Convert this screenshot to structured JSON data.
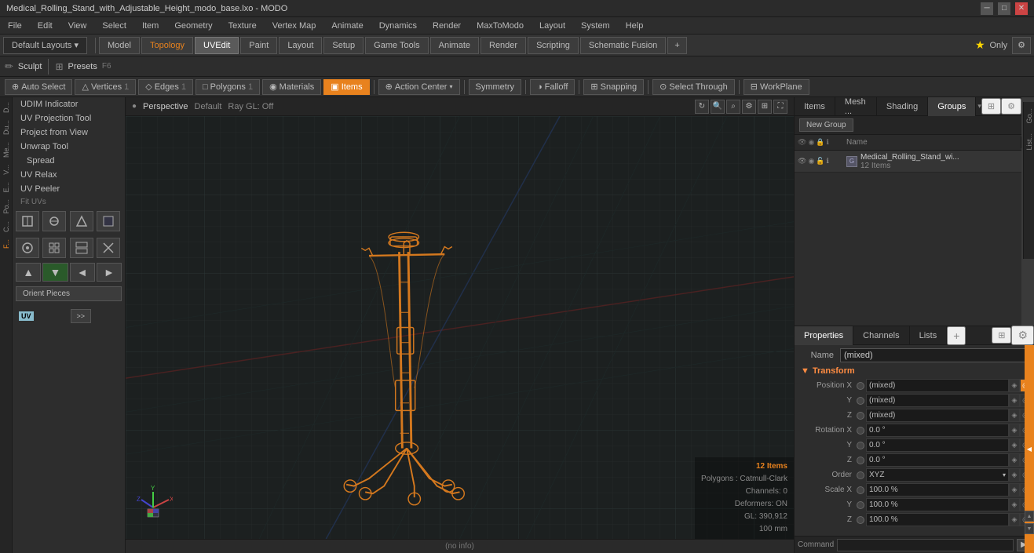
{
  "titlebar": {
    "title": "Medical_Rolling_Stand_with_Adjustable_Height_modo_base.lxo - MODO",
    "min": "─",
    "max": "□",
    "close": "✕"
  },
  "menubar": {
    "items": [
      "File",
      "Edit",
      "View",
      "Select",
      "Item",
      "Geometry",
      "Texture",
      "Vertex Map",
      "Animate",
      "Dynamics",
      "Render",
      "MaxToModo",
      "Layout",
      "System",
      "Help"
    ]
  },
  "toolbar": {
    "layouts_label": "Default Layouts ▾",
    "tabs": [
      {
        "label": "Model",
        "active": false
      },
      {
        "label": "Topology",
        "active": false
      },
      {
        "label": "UVEdit",
        "active": true
      },
      {
        "label": "Paint",
        "active": false
      },
      {
        "label": "Layout",
        "active": false
      },
      {
        "label": "Setup",
        "active": false
      },
      {
        "label": "Game Tools",
        "active": false
      },
      {
        "label": "Animate",
        "active": false
      },
      {
        "label": "Render",
        "active": false
      },
      {
        "label": "Scripting",
        "active": false
      },
      {
        "label": "Schematic Fusion",
        "active": false
      }
    ],
    "add_btn": "+",
    "star_btn": "★",
    "only_label": "Only",
    "settings_btn": "⚙"
  },
  "sculpt_bar": {
    "sculpt_label": "Sculpt",
    "presets_label": "Presets",
    "presets_shortcut": "F6"
  },
  "selection_bar": {
    "auto_select": "Auto Select",
    "vertices": "Vertices",
    "edges": "Edges",
    "polygons": "Polygons",
    "materials": "Materials",
    "items": "Items",
    "action_center": "Action Center",
    "symmetry": "Symmetry",
    "falloff": "Falloff",
    "snapping": "Snapping",
    "select_through": "Select Through",
    "workplane": "WorkPlane"
  },
  "left_tools": {
    "items": [
      {
        "label": "UDIM Indicator"
      },
      {
        "label": "UV Projection Tool"
      },
      {
        "label": "Project from View"
      },
      {
        "label": "Unwrap Tool"
      },
      {
        "label": "Spread",
        "indent": true
      },
      {
        "label": "UV Relax"
      },
      {
        "label": "UV Peeler"
      },
      {
        "label": "Fit UVs",
        "section": true
      }
    ],
    "tool_icons_row1": [
      "⊕",
      "☕",
      "⊞",
      "▣"
    ],
    "tool_icons_row2": [
      "☼",
      "⊡",
      "▦",
      "▤"
    ],
    "arrow_btns": [
      "▲",
      "▼",
      "◄",
      "►"
    ],
    "orient_label": "Orient Pieces",
    "uv_badge": "UV",
    "expand_btn": ">>"
  },
  "left_sidebar_tabs": [
    "D...",
    "Du...",
    "Me...",
    "V...",
    "E...",
    "Po...",
    "C...",
    "F..."
  ],
  "viewport": {
    "view_label": "Perspective",
    "shading_label": "Default",
    "ray_label": "Ray GL: Off",
    "status": {
      "items": "12 Items",
      "polygons": "Polygons : Catmull-Clark",
      "channels": "Channels: 0",
      "deformers": "Deformers: ON",
      "gl": "GL: 390,912",
      "size": "100 mm"
    },
    "bottom_status": "(no info)"
  },
  "right_panel": {
    "tabs": [
      "Items",
      "Mesh ...",
      "Shading",
      "Groups"
    ],
    "active_tab": "Groups",
    "expand_btn": "⊞",
    "settings_btn": "⚙",
    "new_group_btn": "New Group",
    "columns": {
      "name": "Name"
    },
    "groups": [
      {
        "type": "group",
        "icon": "G",
        "name": "Medical_Rolling_Stand_wi...",
        "count": "12 Items",
        "children": []
      }
    ]
  },
  "properties": {
    "tabs": [
      "Properties",
      "Channels",
      "Lists"
    ],
    "add_btn": "+",
    "name_label": "Name",
    "name_value": "(mixed)",
    "transform_label": "Transform",
    "fields": [
      {
        "label": "Position X",
        "value": "(mixed)",
        "dot_color": "grey"
      },
      {
        "label": "Y",
        "value": "(mixed)",
        "dot_color": "grey"
      },
      {
        "label": "Z",
        "value": "(mixed)",
        "dot_color": "grey"
      },
      {
        "label": "Rotation X",
        "value": "0.0 °",
        "dot_color": "grey"
      },
      {
        "label": "Y",
        "value": "0.0 °",
        "dot_color": "grey"
      },
      {
        "label": "Z",
        "value": "0.0 °",
        "dot_color": "grey"
      },
      {
        "label": "Order",
        "value": "XYZ",
        "dot_color": "grey",
        "type": "select"
      },
      {
        "label": "Scale X",
        "value": "100.0 %",
        "dot_color": "grey"
      },
      {
        "label": "Y",
        "value": "100.0 %",
        "dot_color": "grey"
      },
      {
        "label": "Z",
        "value": "100.0 %",
        "dot_color": "grey"
      }
    ]
  },
  "command_bar": {
    "label": "Command",
    "placeholder": ""
  }
}
